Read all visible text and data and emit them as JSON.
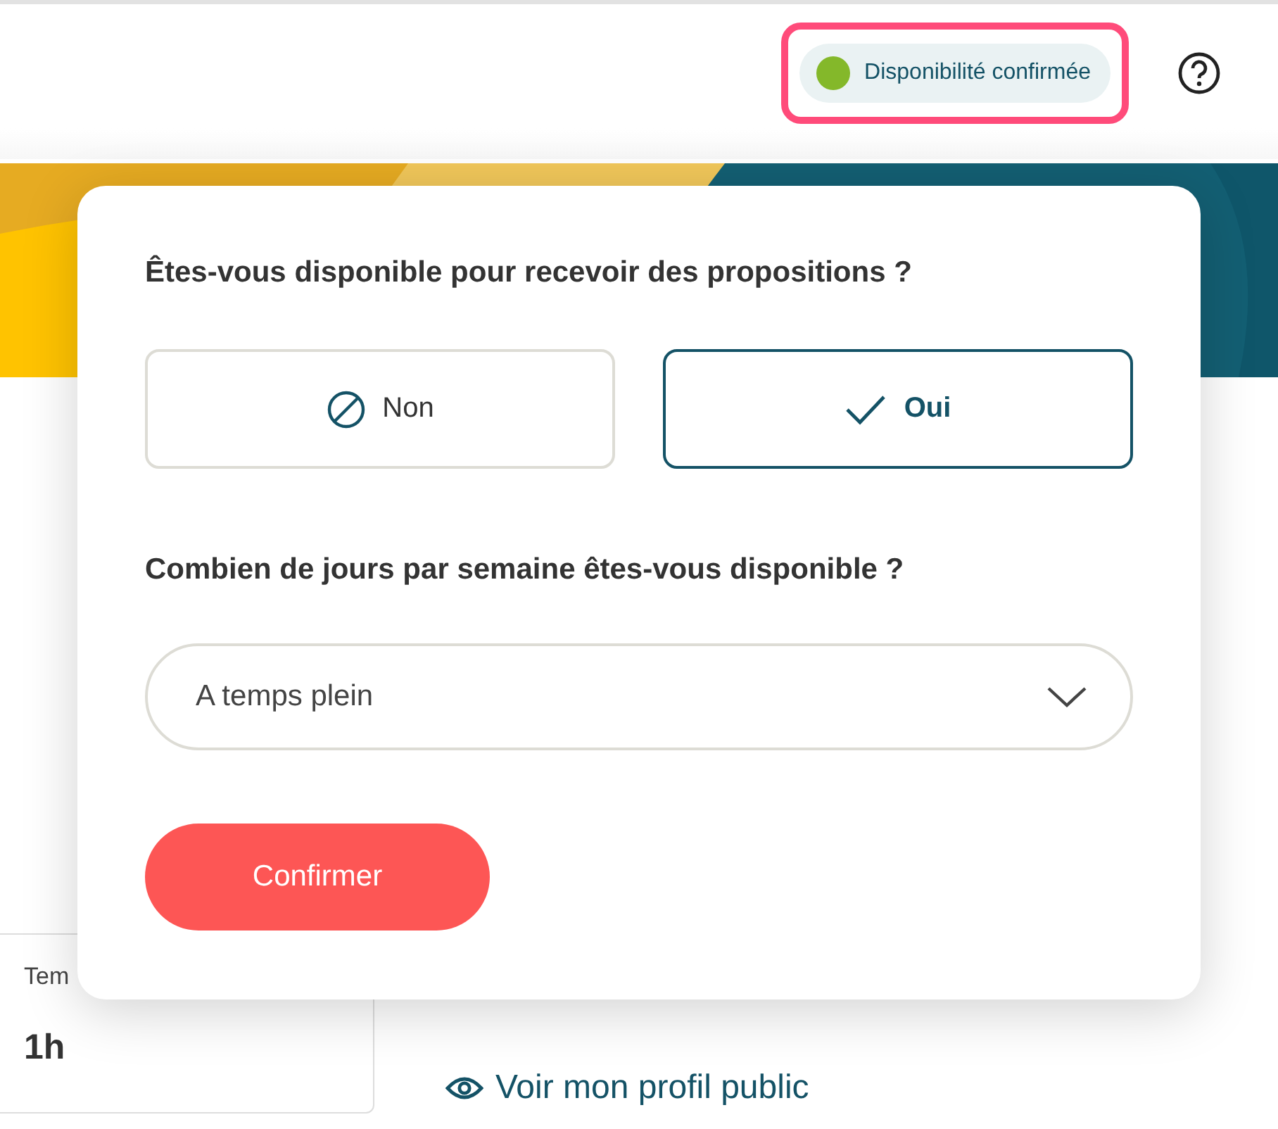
{
  "header": {
    "status_badge": {
      "label": "Disponibilité confirmée",
      "color": "#84b82a",
      "highlighted": true
    }
  },
  "availability_popover": {
    "question": "Êtes-vous disponible pour recevoir des propositions ?",
    "options": [
      {
        "label": "Non",
        "kind": "none",
        "selected": false
      },
      {
        "label": "Oui",
        "kind": "check",
        "selected": true
      }
    ],
    "days_question": "Combien de jours par semaine êtes-vous disponible ?",
    "days_select": {
      "value": "A temps plein"
    },
    "confirm_button": "Confirmer"
  },
  "stat_card": {
    "label": "Tem",
    "value": "1h"
  },
  "profile_link": "Voir mon profil public"
}
